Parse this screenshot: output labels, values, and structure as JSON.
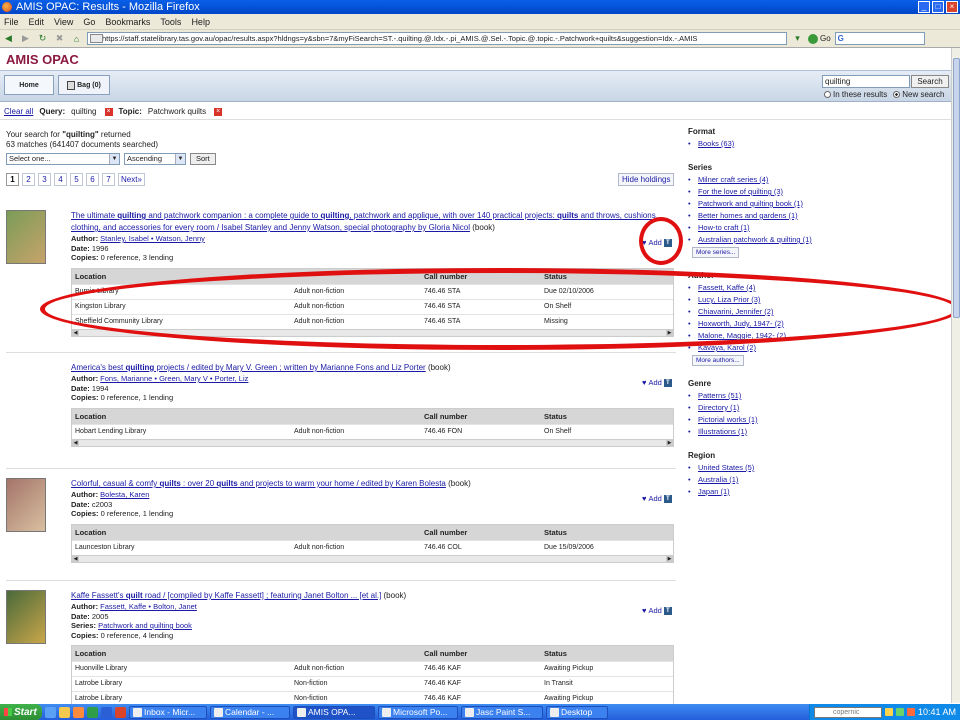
{
  "window": {
    "title": "AMIS OPAC: Results - Mozilla Firefox"
  },
  "menu": [
    "File",
    "Edit",
    "View",
    "Go",
    "Bookmarks",
    "Tools",
    "Help"
  ],
  "toolbar": {
    "url": "https://staff.statelibrary.tas.gov.au/opac/results.aspx?hldngs=y&sbn=7&myFiSearch=ST.-.quilting.@.Idx.-.pi_AMIS.@.Sel.-.Topic.@.topic.-.Patchwork+quilts&suggestion=Idx.-.AMIS",
    "go_label": "Go",
    "search_engine": "G"
  },
  "site": {
    "logo": "AMIS OPAC",
    "tabs": {
      "home": "Home",
      "bag": "Bag (0)"
    },
    "search_value": "quilting",
    "search_button": "Search",
    "scope_in_results": "In these results",
    "scope_new": "New search"
  },
  "query": {
    "clear_all": "Clear all",
    "query_label": "Query:",
    "query_value": "quilting",
    "topic_label": "Topic:",
    "topic_value": "Patchwork quilts"
  },
  "results": {
    "summary_prefix": "Your search for",
    "summary_term": "\"quilting\"",
    "summary_suffix": "returned",
    "summary_count": "63 matches (641407 documents searched)",
    "sort_select": "Select one...",
    "sort_order": "Ascending",
    "sort_button": "Sort",
    "pages": [
      "1",
      "2",
      "3",
      "4",
      "5",
      "6",
      "7"
    ],
    "next": "Next»",
    "hide_holdings": "Hide holdings",
    "holdings_headers": {
      "location": "Location",
      "call": "Call number",
      "status": "Status"
    },
    "add_label": "Add",
    "records": [
      {
        "title_html": "<span class='lnk'>The ultimate <b>quilting</b> and patchwork companion : a complete guide to <b>quilting</b>, patchwork and applique, with over 140 practical projects: <b>quilts</b> and throws, cushions, clothing, and accessories for every room / Isabel Stanley and Jenny Watson, special photography by Gloria Nicol</span> (book)",
        "author": "Stanley, Isabel • Watson, Jenny",
        "date": "1996",
        "series": "",
        "copies": "0 reference, 3 lending",
        "holdings": [
          [
            "Burnie Library",
            "Adult non-fiction",
            "746.46 STA",
            "Due 02/10/2006"
          ],
          [
            "Kingston Library",
            "Adult non-fiction",
            "746.46 STA",
            "On Shelf"
          ],
          [
            "Sheffield Community Library",
            "Adult non-fiction",
            "746.46 STA",
            "Missing"
          ]
        ]
      },
      {
        "title_html": "<span class='lnk'>America's best <b>quilting</b> projects / edited by Mary V. Green ; written by Marianne Fons and Liz Porter</span> (book)",
        "author": "Fons, Marianne • Green, Mary V • Porter, Liz",
        "date": "1994",
        "series": "",
        "copies": "0 reference, 1 lending",
        "holdings": [
          [
            "Hobart Lending Library",
            "Adult non-fiction",
            "746.46 FON",
            "On Shelf"
          ]
        ]
      },
      {
        "title_html": "<span class='lnk'>Colorful, casual &amp; comfy <b>quilts</b> : over 20 <b>quilts</b> and projects to warm your home / edited by Karen Bolesta</span> (book)",
        "author": "Bolesta, Karen",
        "date": "c2003",
        "series": "",
        "copies": "0 reference, 1 lending",
        "holdings": [
          [
            "Launceston Library",
            "Adult non-fiction",
            "746.46 COL",
            "Due 15/09/2006"
          ]
        ]
      },
      {
        "title_html": "<span class='lnk'>Kaffe Fassett's <b>quilt</b> road / [compiled by Kaffe Fassett] ; featuring Janet Bolton ... [et al.]</span> (book)",
        "author": "Fassett, Kaffe • Bolton, Janet",
        "date": "2005",
        "series": "Patchwork and quilting book",
        "copies": "0 reference, 4 lending",
        "holdings": [
          [
            "Huonville Library",
            "Adult non-fiction",
            "746.46 KAF",
            "Awaiting Pickup"
          ],
          [
            "Latrobe Library",
            "Non-fiction",
            "746.46 KAF",
            "In Transit"
          ],
          [
            "Latrobe Library",
            "Non-fiction",
            "746.46 KAF",
            "Awaiting Pickup"
          ]
        ]
      }
    ]
  },
  "facets": [
    {
      "heading": "Format",
      "items": [
        "Books (63)"
      ],
      "more": ""
    },
    {
      "heading": "Series",
      "items": [
        "Milner craft series (4)",
        "For the love of quilting (3)",
        "Patchwork and quilting book (1)",
        "Better homes and gardens (1)",
        "How-to craft (1)",
        "Australian patchwork & quilting (1)"
      ],
      "more": "More series..."
    },
    {
      "heading": "Author",
      "items": [
        "Fassett, Kaffe (4)",
        "Lucy, Liza Prior (3)",
        "Chiavarini, Jennifer (2)",
        "Hoxworth, Judy, 1947- (2)",
        "Malone, Maggie, 1942- (2)",
        "Kavaya, Karol (2)"
      ],
      "more": "More authors..."
    },
    {
      "heading": "Genre",
      "items": [
        "Patterns (51)",
        "Directory (1)",
        "Pictorial works (1)",
        "Illustrations (1)"
      ],
      "more": ""
    },
    {
      "heading": "Region",
      "items": [
        "United States (5)",
        "Australia (1)",
        "Japan (1)"
      ],
      "more": ""
    }
  ],
  "taskbar": {
    "start": "Start",
    "tasks": [
      "Inbox - Micr...",
      "Calendar - ...",
      "AMIS OPA...",
      "Microsoft Po...",
      "Jasc Paint S...",
      "Desktop"
    ],
    "tray_search": "copernic",
    "clock": "10:41 AM"
  },
  "colors": {
    "accent": "#8b1a3f",
    "annotation": "#e01010",
    "link": "#1a1aa6"
  }
}
